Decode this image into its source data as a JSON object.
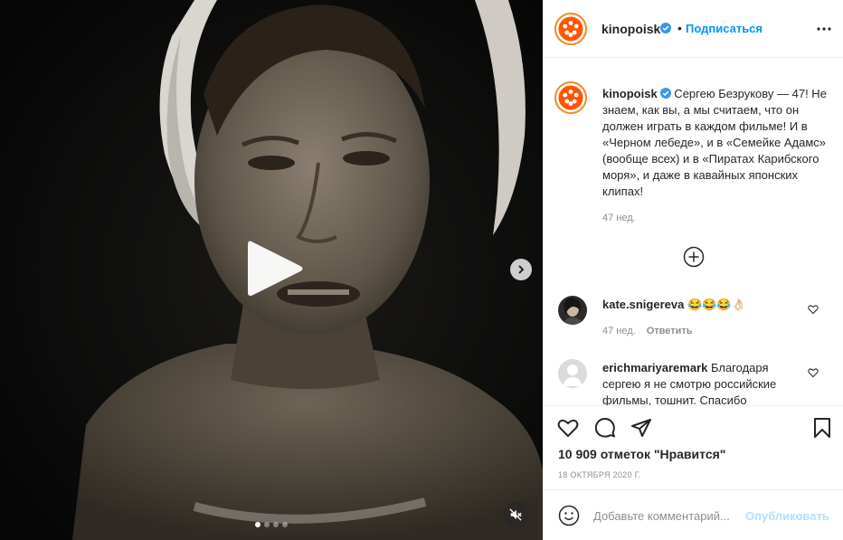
{
  "post": {
    "username": "kinopoisk",
    "follow_label": "Подписаться",
    "separator": "•",
    "caption_user": "kinopoisk",
    "caption_text": " Сергею Безрукову — 47! Не знаем, как вы, а мы считаем, что он должен играть в каждом фильме! И в «Черном лебеде», и в «Семейке Адамс» (вообще всех) и в «Пиратах Карибского моря», и даже в кавайных японских клипах!",
    "caption_time": "47 нед.",
    "likes": "10 909 отметок \"Нравится\"",
    "date": "18 октября 2020 г."
  },
  "comments": [
    {
      "user": "kate.snigereva",
      "text": " 😂😂😂👌🏻",
      "time": "47 нед.",
      "reply": "Ответить"
    },
    {
      "user": "erichmariyaremark",
      "text": " Благодаря сергею я не смотрю российские фильмы, тошнит. Спасибо"
    }
  ],
  "comment_box": {
    "placeholder": "Добавьте комментарий...",
    "publish_label": "Опубликовать"
  },
  "media": {
    "carousel_count": 4,
    "carousel_active": 1
  },
  "icons": {
    "header_avatar": "kinopoisk-logo-icon",
    "verified": "verified-badge-icon",
    "more": "more-options-icon",
    "play": "play-icon",
    "next": "chevron-right-icon",
    "mute": "muted-speaker-icon",
    "load_more": "plus-circle-icon",
    "like": "heart-icon",
    "comment": "comment-bubble-icon",
    "share": "paper-plane-icon",
    "save": "bookmark-icon",
    "emoji": "smiley-icon"
  },
  "colors": {
    "brand_orange": "#ff5500",
    "link_blue": "#0095f6",
    "publish_disabled": "#b2dffc",
    "verified_blue": "#3897f0"
  }
}
